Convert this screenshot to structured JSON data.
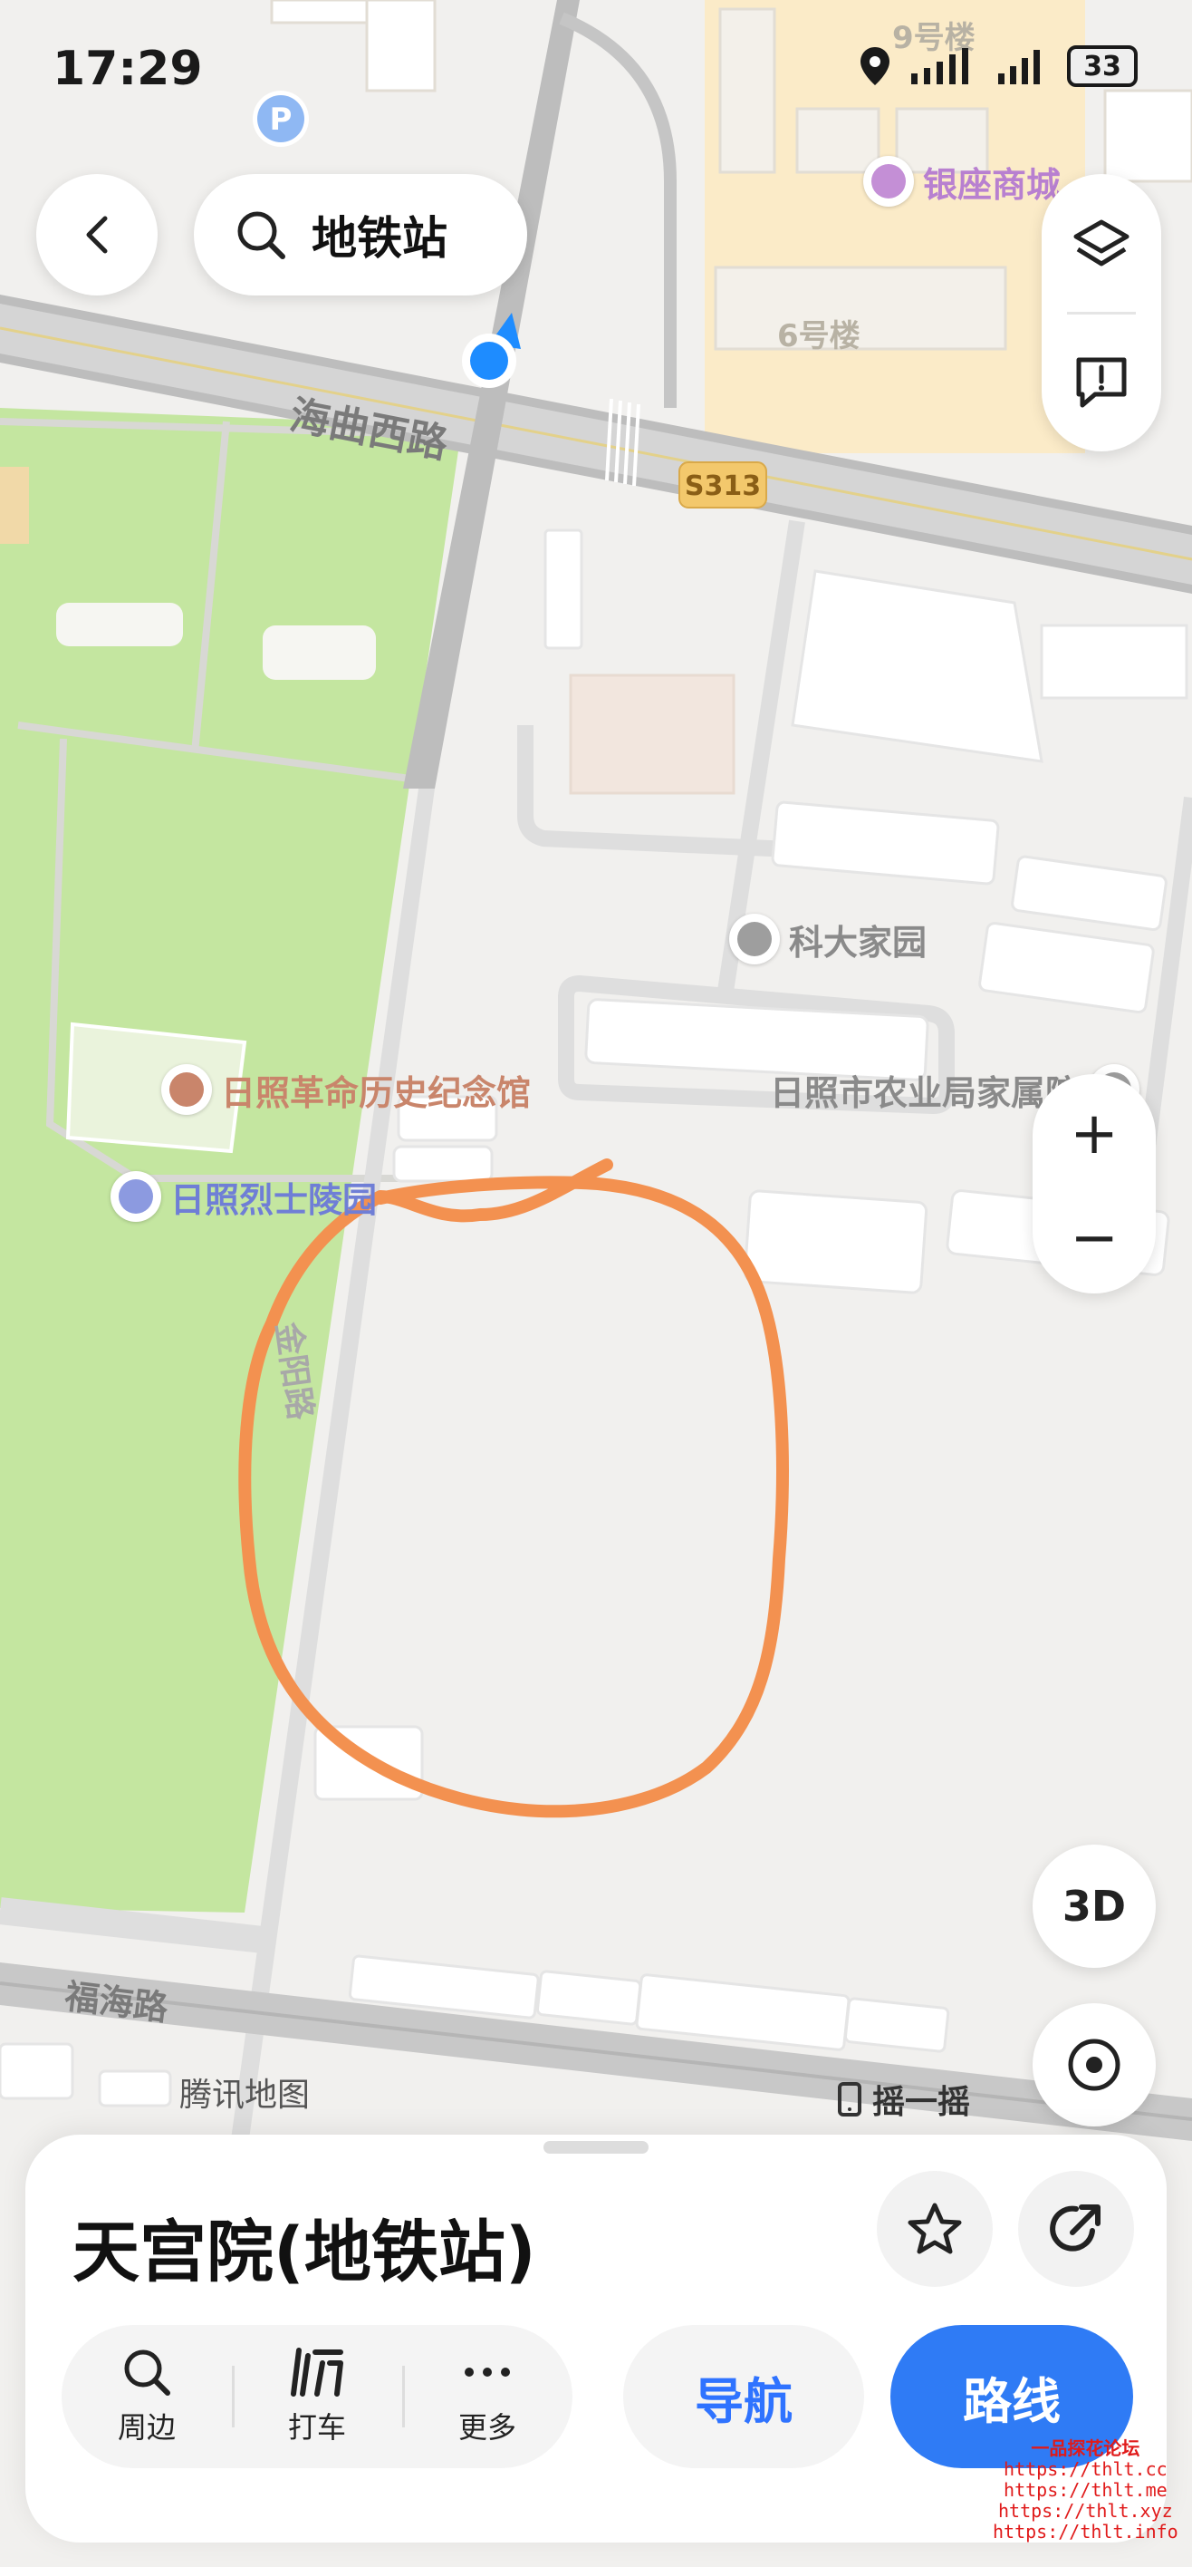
{
  "status_bar": {
    "time": "17:29",
    "battery": "33"
  },
  "search": {
    "query": "地铁站"
  },
  "map": {
    "roads": [
      "海曲西路",
      "福海路",
      "金阳路"
    ],
    "road_badge": "S313",
    "buildings": [
      "9号楼",
      "6号楼"
    ],
    "pois": [
      {
        "name": "银座商城",
        "color": "#c48fd6"
      },
      {
        "name": "科大家园",
        "color": "#9e9e9e"
      },
      {
        "name": "日照革命历史纪念馆",
        "color": "#c9856b"
      },
      {
        "name": "日照市农业局家属院",
        "color": "#9e9e9e"
      },
      {
        "name": "日照烈士陵园",
        "color": "#8c9ae0"
      }
    ],
    "provider": "腾讯地图",
    "shake_label": "摇一摇",
    "drawing_color": "#f39150",
    "park_color": "#c4e6a0",
    "location_color": "#1e8cff"
  },
  "controls": {
    "zoom_in": "+",
    "zoom_out": "−",
    "three_d": "3D"
  },
  "place": {
    "title": "天宫院(地铁站)",
    "actions": [
      {
        "label": "周边",
        "icon": "search-icon"
      },
      {
        "label": "打车",
        "icon": "taxi-icon"
      },
      {
        "label": "更多",
        "icon": "more-icon"
      }
    ],
    "navigate_label": "导航",
    "route_label": "路线"
  },
  "watermark": [
    "一品探花论坛",
    "https://thlt.cc",
    "https://thlt.me",
    "https://thlt.xyz",
    "https://thlt.info"
  ]
}
